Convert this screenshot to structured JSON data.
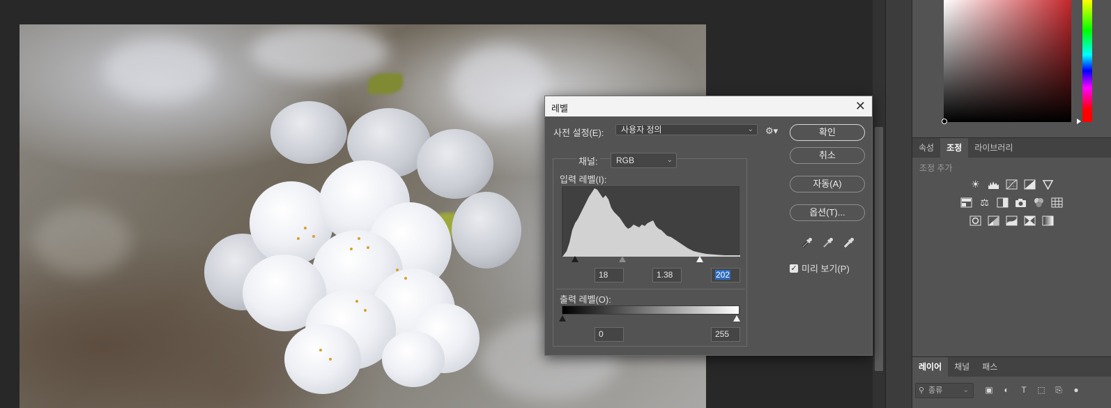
{
  "dialog": {
    "title": "레벨",
    "preset_label": "사전 설정(E):",
    "preset_value": "사용자 정의",
    "channel_label": "채널:",
    "channel_value": "RGB",
    "input_levels_label": "입력 레벨(I):",
    "input_black": "18",
    "input_gamma": "1.38",
    "input_white": "202",
    "output_levels_label": "출력 레벨(O):",
    "output_black": "0",
    "output_white": "255",
    "buttons": {
      "ok": "확인",
      "cancel": "취소",
      "auto": "자동(A)",
      "options": "옵션(T)..."
    },
    "preview_label": "미리 보기(P)",
    "preview_checked": true,
    "close_glyph": "✕"
  },
  "panels": {
    "top_tabs": [
      "속성",
      "조정",
      "라이브러리"
    ],
    "active_top_tab": "조정",
    "adjustments_subtitle": "조정 추가",
    "bottom_tabs": [
      "레이어",
      "채널",
      "패스"
    ],
    "active_bottom_tab": "레이어",
    "layer_filter_value": "종류"
  },
  "colors": {
    "panel_bg": "#535353",
    "dialog_title_bg": "#f3f3f3",
    "selection": "#2d6cc0",
    "histogram_fill": "#d2d2d2"
  },
  "icons": {
    "adjust_row1": [
      "brightness-icon",
      "levels-icon",
      "curves-icon",
      "exposure-icon",
      "vibrance-icon"
    ],
    "adjust_row2": [
      "hue-saturation-icon",
      "color-balance-icon",
      "black-white-icon",
      "photo-filter-icon",
      "channel-mixer-icon",
      "color-lookup-icon"
    ],
    "adjust_row3": [
      "invert-icon",
      "posterize-icon",
      "threshold-icon",
      "selective-color-icon",
      "gradient-map-icon"
    ]
  }
}
